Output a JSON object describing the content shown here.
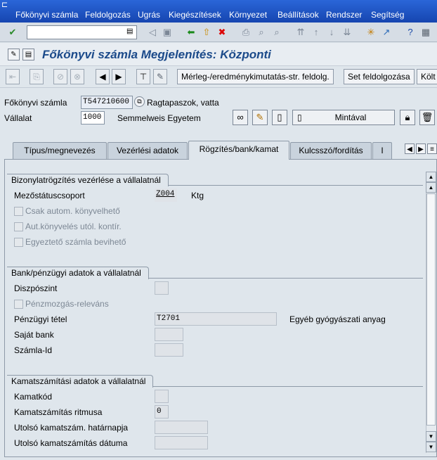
{
  "menubar": {
    "items": [
      "Főkönyvi számla",
      "Feldolgozás",
      "Ugrás",
      "Kiegészítések",
      "Környezet",
      "Beállítások",
      "Rendszer",
      "Segítség"
    ]
  },
  "toolbar": {
    "command_value": ""
  },
  "title": "Főkönyvi számla Megjelenítés: Központi",
  "app_toolbar": {
    "btn_balance_structure": "Mérleg-/eredménykimutatás-str. feldolg.",
    "btn_set_processing": "Set feldolgozása",
    "btn_cost": "Költ"
  },
  "header": {
    "account_label": "Főkönyvi számla",
    "account_value": "T547210600",
    "account_desc": "Ragtapaszok, vatta",
    "company_label": "Vállalat",
    "company_value": "1000",
    "company_desc": "Semmelweis Egyetem",
    "template_button": "Mintával"
  },
  "tabs": [
    {
      "label": "Típus/megnevezés"
    },
    {
      "label": "Vezérlési adatok"
    },
    {
      "label": "Rögzítés/bank/kamat"
    },
    {
      "label": "Kulcsszó/fordítás"
    },
    {
      "label": "I"
    }
  ],
  "group1": {
    "title": "Bizonylatrögzítés vezérlése a vállalatnál",
    "field_status_label": "Mezőstátuscsoport",
    "field_status_value": "Z004",
    "field_status_desc": "Ktg",
    "chk1": "Csak autom. könyvelhető",
    "chk2": "Aut.könyvelés utól. kontír.",
    "chk3": "Egyeztető számla bevihető"
  },
  "group2": {
    "title": "Bank/pénzügyi adatok a vállalatnál",
    "planning_level_label": "Diszpószint",
    "cash_relevant_label": "Pénzmozgás-releváns",
    "fin_item_label": "Pénzügyi tétel",
    "fin_item_value": "T2701",
    "fin_item_desc": "Egyéb gyógyászati anyag",
    "house_bank_label": "Saját bank",
    "account_id_label": "Számla-Id"
  },
  "group3": {
    "title": "Kamatszámítási adatok a vállalatnál",
    "interest_key_label": "Kamatkód",
    "interest_cycle_label": "Kamatszámítás ritmusa",
    "interest_cycle_value": "0",
    "last_key_date_label": "Utolsó kamatszám. határnapja",
    "last_run_label": "Utolsó kamatszámítás dátuma"
  }
}
